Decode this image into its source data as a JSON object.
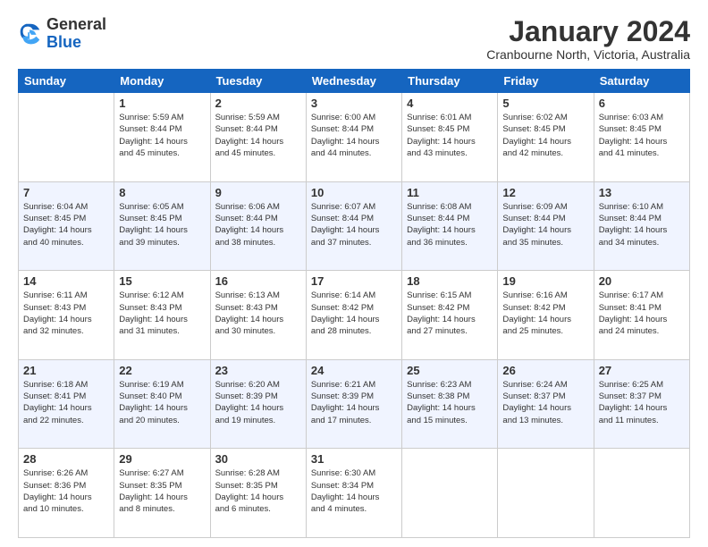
{
  "logo": {
    "line1": "General",
    "line2": "Blue"
  },
  "title": "January 2024",
  "subtitle": "Cranbourne North, Victoria, Australia",
  "days_of_week": [
    "Sunday",
    "Monday",
    "Tuesday",
    "Wednesday",
    "Thursday",
    "Friday",
    "Saturday"
  ],
  "weeks": [
    [
      {
        "day": "",
        "info": ""
      },
      {
        "day": "1",
        "info": "Sunrise: 5:59 AM\nSunset: 8:44 PM\nDaylight: 14 hours\nand 45 minutes."
      },
      {
        "day": "2",
        "info": "Sunrise: 5:59 AM\nSunset: 8:44 PM\nDaylight: 14 hours\nand 45 minutes."
      },
      {
        "day": "3",
        "info": "Sunrise: 6:00 AM\nSunset: 8:44 PM\nDaylight: 14 hours\nand 44 minutes."
      },
      {
        "day": "4",
        "info": "Sunrise: 6:01 AM\nSunset: 8:45 PM\nDaylight: 14 hours\nand 43 minutes."
      },
      {
        "day": "5",
        "info": "Sunrise: 6:02 AM\nSunset: 8:45 PM\nDaylight: 14 hours\nand 42 minutes."
      },
      {
        "day": "6",
        "info": "Sunrise: 6:03 AM\nSunset: 8:45 PM\nDaylight: 14 hours\nand 41 minutes."
      }
    ],
    [
      {
        "day": "7",
        "info": "Sunrise: 6:04 AM\nSunset: 8:45 PM\nDaylight: 14 hours\nand 40 minutes."
      },
      {
        "day": "8",
        "info": "Sunrise: 6:05 AM\nSunset: 8:45 PM\nDaylight: 14 hours\nand 39 minutes."
      },
      {
        "day": "9",
        "info": "Sunrise: 6:06 AM\nSunset: 8:44 PM\nDaylight: 14 hours\nand 38 minutes."
      },
      {
        "day": "10",
        "info": "Sunrise: 6:07 AM\nSunset: 8:44 PM\nDaylight: 14 hours\nand 37 minutes."
      },
      {
        "day": "11",
        "info": "Sunrise: 6:08 AM\nSunset: 8:44 PM\nDaylight: 14 hours\nand 36 minutes."
      },
      {
        "day": "12",
        "info": "Sunrise: 6:09 AM\nSunset: 8:44 PM\nDaylight: 14 hours\nand 35 minutes."
      },
      {
        "day": "13",
        "info": "Sunrise: 6:10 AM\nSunset: 8:44 PM\nDaylight: 14 hours\nand 34 minutes."
      }
    ],
    [
      {
        "day": "14",
        "info": "Sunrise: 6:11 AM\nSunset: 8:43 PM\nDaylight: 14 hours\nand 32 minutes."
      },
      {
        "day": "15",
        "info": "Sunrise: 6:12 AM\nSunset: 8:43 PM\nDaylight: 14 hours\nand 31 minutes."
      },
      {
        "day": "16",
        "info": "Sunrise: 6:13 AM\nSunset: 8:43 PM\nDaylight: 14 hours\nand 30 minutes."
      },
      {
        "day": "17",
        "info": "Sunrise: 6:14 AM\nSunset: 8:42 PM\nDaylight: 14 hours\nand 28 minutes."
      },
      {
        "day": "18",
        "info": "Sunrise: 6:15 AM\nSunset: 8:42 PM\nDaylight: 14 hours\nand 27 minutes."
      },
      {
        "day": "19",
        "info": "Sunrise: 6:16 AM\nSunset: 8:42 PM\nDaylight: 14 hours\nand 25 minutes."
      },
      {
        "day": "20",
        "info": "Sunrise: 6:17 AM\nSunset: 8:41 PM\nDaylight: 14 hours\nand 24 minutes."
      }
    ],
    [
      {
        "day": "21",
        "info": "Sunrise: 6:18 AM\nSunset: 8:41 PM\nDaylight: 14 hours\nand 22 minutes."
      },
      {
        "day": "22",
        "info": "Sunrise: 6:19 AM\nSunset: 8:40 PM\nDaylight: 14 hours\nand 20 minutes."
      },
      {
        "day": "23",
        "info": "Sunrise: 6:20 AM\nSunset: 8:39 PM\nDaylight: 14 hours\nand 19 minutes."
      },
      {
        "day": "24",
        "info": "Sunrise: 6:21 AM\nSunset: 8:39 PM\nDaylight: 14 hours\nand 17 minutes."
      },
      {
        "day": "25",
        "info": "Sunrise: 6:23 AM\nSunset: 8:38 PM\nDaylight: 14 hours\nand 15 minutes."
      },
      {
        "day": "26",
        "info": "Sunrise: 6:24 AM\nSunset: 8:37 PM\nDaylight: 14 hours\nand 13 minutes."
      },
      {
        "day": "27",
        "info": "Sunrise: 6:25 AM\nSunset: 8:37 PM\nDaylight: 14 hours\nand 11 minutes."
      }
    ],
    [
      {
        "day": "28",
        "info": "Sunrise: 6:26 AM\nSunset: 8:36 PM\nDaylight: 14 hours\nand 10 minutes."
      },
      {
        "day": "29",
        "info": "Sunrise: 6:27 AM\nSunset: 8:35 PM\nDaylight: 14 hours\nand 8 minutes."
      },
      {
        "day": "30",
        "info": "Sunrise: 6:28 AM\nSunset: 8:35 PM\nDaylight: 14 hours\nand 6 minutes."
      },
      {
        "day": "31",
        "info": "Sunrise: 6:30 AM\nSunset: 8:34 PM\nDaylight: 14 hours\nand 4 minutes."
      },
      {
        "day": "",
        "info": ""
      },
      {
        "day": "",
        "info": ""
      },
      {
        "day": "",
        "info": ""
      }
    ]
  ]
}
